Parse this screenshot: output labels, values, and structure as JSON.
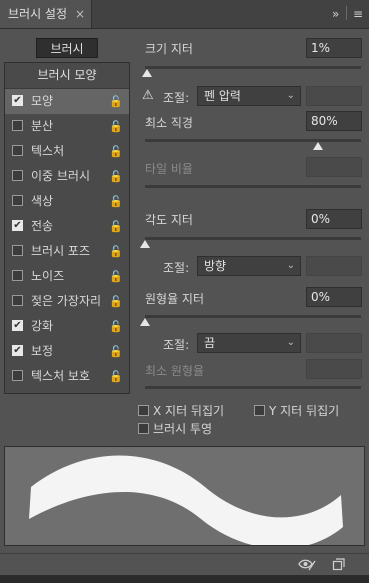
{
  "header": {
    "tab_title": "브러시 설정",
    "tab_close": "×",
    "collapse": "»",
    "menu": "≡"
  },
  "left": {
    "brush_button": "브러시",
    "shape_header": "브러시 모양",
    "items": [
      {
        "label": "모양",
        "checked": true,
        "selected": true
      },
      {
        "label": "분산",
        "checked": false
      },
      {
        "label": "텍스처",
        "checked": false
      },
      {
        "label": "이중 브러시",
        "checked": false
      },
      {
        "label": "색상",
        "checked": false
      },
      {
        "label": "전송",
        "checked": true
      },
      {
        "label": "브러시 포즈",
        "checked": false
      },
      {
        "label": "노이즈",
        "checked": false
      },
      {
        "label": "젖은 가장자리",
        "checked": false
      },
      {
        "label": "강화",
        "checked": true
      },
      {
        "label": "보정",
        "checked": true
      },
      {
        "label": "텍스처 보호",
        "checked": false
      }
    ],
    "lock_glyph": "🔓",
    "check_glyph": "✔"
  },
  "right": {
    "size_jitter": {
      "label": "크기 지터",
      "value": "1%",
      "level": 0.01
    },
    "control1": {
      "label": "조절:",
      "warn": "⚠",
      "value": "펜 압력"
    },
    "min_diameter": {
      "label": "최소 직경",
      "value": "80%",
      "level": 0.8
    },
    "tilt_scale": {
      "label": "타일 비율",
      "value": ""
    },
    "angle_jitter": {
      "label": "각도 지터",
      "value": "0%",
      "level": 0.0
    },
    "control2": {
      "label": "조절:",
      "value": "방향"
    },
    "roundness_jitter": {
      "label": "원형율 지터",
      "value": "0%",
      "level": 0.0
    },
    "control3": {
      "label": "조절:",
      "value": "끔"
    },
    "min_roundness": {
      "label": "최소 원형율",
      "value": ""
    },
    "flip_x": {
      "label": "X 지터 뒤집기",
      "checked": false
    },
    "flip_y": {
      "label": "Y 지터 뒤집기",
      "checked": false
    },
    "projection": {
      "label": "브러시 투영",
      "checked": false
    },
    "chevron": "⌄"
  },
  "footer": {
    "eye_icon": "eye-icon",
    "new_icon": "new-preset-icon"
  }
}
